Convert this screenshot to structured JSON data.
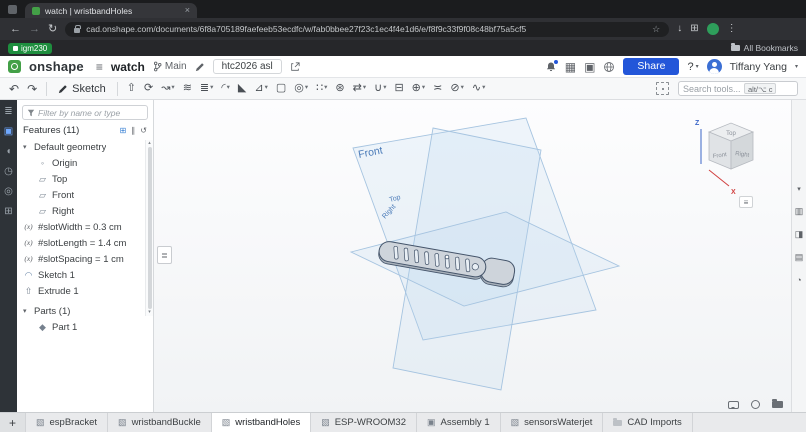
{
  "colors": {
    "accent_blue": "#2356d9",
    "brand_green": "#43a047",
    "axis_red": "#d14040",
    "axis_blue": "#3b66c8",
    "plane_blue": "#a6c4e0"
  },
  "glyphs": {
    "caret_down": "▾",
    "caret_up": "▴",
    "close": "×",
    "plus": "+",
    "back": "←",
    "forward": "→",
    "reload": "↻",
    "kebab": "⋮",
    "hamburger": "≡",
    "undo": "↶",
    "redo": "↷",
    "star": "☆",
    "download": "↓",
    "extensions": "⊞",
    "handle": "≣",
    "apps": "▦",
    "clone": "▣",
    "help": "?"
  },
  "browser": {
    "tab_title": "watch | wristbandHoles",
    "url": "cad.onshape.com/documents/6f8a705189faefeeb53ecdfc/w/fab0bbee27f23c1ec4f4e1d6/e/f8f9c33f9f08c48bf75a5cf5",
    "extension_label": "igm230",
    "bookmarks_label": "All Bookmarks"
  },
  "header": {
    "brand": "onshape",
    "doc_title": "watch",
    "branch_label": "Main",
    "doc_chip": "htc2026 asl",
    "share_label": "Share",
    "user_name": "Tiffany Yang"
  },
  "toolbar": {
    "sketch_label": "Sketch",
    "search_placeholder": "Search tools...",
    "shortcut": "alt/⌥ c",
    "tools": [
      {
        "name": "extrude",
        "glyph": "⇧"
      },
      {
        "name": "revolve",
        "glyph": "⟳"
      },
      {
        "name": "sweep",
        "glyph": "↝",
        "caret": true
      },
      {
        "name": "loft",
        "glyph": "≋"
      },
      {
        "name": "thicken",
        "glyph": "≣",
        "caret": true
      },
      {
        "name": "fillet",
        "glyph": "◜",
        "caret": true
      },
      {
        "name": "chamfer",
        "glyph": "◣"
      },
      {
        "name": "draft",
        "glyph": "⊿",
        "caret": true
      },
      {
        "name": "shell",
        "glyph": "▢"
      },
      {
        "name": "hole",
        "glyph": "◎",
        "caret": true
      },
      {
        "name": "linear-pattern",
        "glyph": "∷",
        "caret": true
      },
      {
        "name": "circular-pattern",
        "glyph": "⊛"
      },
      {
        "name": "mirror",
        "glyph": "⇄",
        "caret": true
      },
      {
        "name": "boolean",
        "glyph": "∪",
        "caret": true
      },
      {
        "name": "split",
        "glyph": "⊟"
      },
      {
        "name": "transform",
        "glyph": "⊕",
        "caret": true
      },
      {
        "name": "offset-surface",
        "glyph": "≍"
      },
      {
        "name": "delete-part",
        "glyph": "⊘",
        "caret": true
      },
      {
        "name": "curves",
        "glyph": "∿",
        "caret": true
      }
    ]
  },
  "left_rail": [
    {
      "name": "document-list",
      "glyph": "≣"
    },
    {
      "name": "feature-list",
      "glyph": "▣"
    },
    {
      "name": "comments",
      "glyph": "◖"
    },
    {
      "name": "history",
      "glyph": "◷"
    },
    {
      "name": "search",
      "glyph": "◎"
    },
    {
      "name": "tables",
      "glyph": "⊞"
    }
  ],
  "feature_panel": {
    "filter_placeholder": "Filter by name or type",
    "features_header": "Features (11)",
    "header_icons": [
      {
        "name": "insert-feature",
        "glyph": "⊞"
      },
      {
        "name": "suppress",
        "glyph": "∥"
      },
      {
        "name": "rollback-history",
        "glyph": "↺"
      }
    ],
    "tree": [
      {
        "label": "Default geometry"
      },
      {
        "label": "Origin",
        "icon": "◦"
      },
      {
        "label": "Top",
        "icon": "▱"
      },
      {
        "label": "Front",
        "icon": "▱"
      },
      {
        "label": "Right",
        "icon": "▱"
      },
      {
        "label": "#slotWidth = 0.3 cm",
        "icon": "(x)"
      },
      {
        "label": "#slotLength = 1.4 cm",
        "icon": "(x)"
      },
      {
        "label": "#slotSpacing = 1 cm",
        "icon": "(x)"
      },
      {
        "label": "Sketch 1",
        "icon": "◠"
      },
      {
        "label": "Extrude 1",
        "icon": "⇧"
      }
    ],
    "parts_header": "Parts (1)",
    "parts": [
      {
        "label": "Part 1",
        "icon": "◆"
      }
    ]
  },
  "viewport": {
    "plane_labels": {
      "front": "Front",
      "top": "Top",
      "right": "Right"
    },
    "view_cube": {
      "top": "Top",
      "front": "Front",
      "right": "Right",
      "axis_x": "X",
      "axis_z": "Z"
    }
  },
  "right_rail": [
    {
      "name": "collapse",
      "glyph": "▾"
    },
    {
      "name": "display-options",
      "glyph": "▥"
    },
    {
      "name": "configurations",
      "glyph": "◨"
    },
    {
      "name": "appearance",
      "glyph": "▤"
    },
    {
      "name": "custom-tables",
      "glyph": "◔"
    }
  ],
  "bottom_bar": {
    "tabs": [
      {
        "label": "espBracket",
        "icon": "▧"
      },
      {
        "label": "wristbandBuckle",
        "icon": "▧"
      },
      {
        "label": "wristbandHoles",
        "icon": "▧"
      },
      {
        "label": "ESP-WROOM32",
        "icon": "▧"
      },
      {
        "label": "Assembly 1",
        "icon": "▣"
      },
      {
        "label": "sensorsWaterjet",
        "icon": "▧"
      },
      {
        "label": "CAD Imports",
        "icon": ""
      }
    ]
  }
}
